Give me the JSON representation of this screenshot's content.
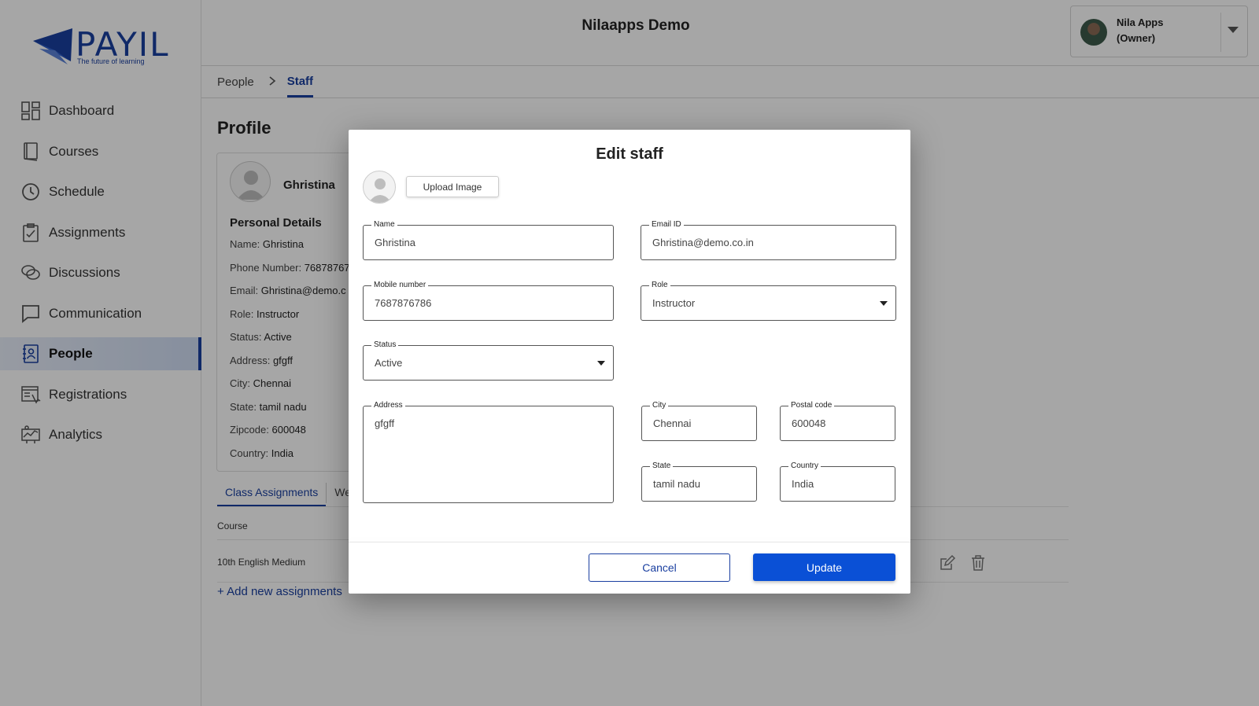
{
  "brand": {
    "logo_text": "PAYIL",
    "tagline": "The future of learning"
  },
  "sidebar": {
    "items": [
      {
        "label": "Dashboard",
        "icon": "dashboard-icon"
      },
      {
        "label": "Courses",
        "icon": "book-icon"
      },
      {
        "label": "Schedule",
        "icon": "clock-icon"
      },
      {
        "label": "Assignments",
        "icon": "clipboard-icon"
      },
      {
        "label": "Discussions",
        "icon": "chat-bubbles-icon"
      },
      {
        "label": "Communication",
        "icon": "message-icon"
      },
      {
        "label": "People",
        "icon": "contacts-icon",
        "active": true
      },
      {
        "label": "Registrations",
        "icon": "registration-form-icon"
      },
      {
        "label": "Analytics",
        "icon": "analytics-icon"
      }
    ]
  },
  "header": {
    "title": "Nilaapps Demo",
    "user": {
      "name": "Nila Apps",
      "role": "(Owner)"
    }
  },
  "breadcrumb": {
    "parent": "People",
    "current": "Staff"
  },
  "profile": {
    "title": "Profile",
    "name": "Ghristina",
    "section_title": "Personal Details",
    "rows": [
      {
        "key": "Name:",
        "value": "Ghristina"
      },
      {
        "key": "Phone Number:",
        "value": "76878767"
      },
      {
        "key": "Email:",
        "value": "Ghristina@demo.c"
      },
      {
        "key": "Role:",
        "value": "Instructor"
      },
      {
        "key": "Status:",
        "value": "Active"
      },
      {
        "key": "Address:",
        "value": "gfgff"
      },
      {
        "key": "City:",
        "value": "Chennai"
      },
      {
        "key": "State:",
        "value": "tamil nadu"
      },
      {
        "key": "Zipcode:",
        "value": "600048"
      },
      {
        "key": "Country:",
        "value": "India"
      }
    ],
    "tabs": [
      "Class Assignments",
      "We"
    ],
    "table": {
      "header": "Course",
      "rows": [
        "10th English Medium"
      ]
    },
    "add_link": "+ Add new assignments"
  },
  "modal": {
    "title": "Edit staff",
    "upload_label": "Upload Image",
    "fields": {
      "name": {
        "label": "Name",
        "value": "Ghristina"
      },
      "email": {
        "label": "Email ID",
        "value": "Ghristina@demo.co.in"
      },
      "mobile": {
        "label": "Mobile number",
        "value": "7687876786"
      },
      "role": {
        "label": "Role",
        "value": "Instructor"
      },
      "status": {
        "label": "Status",
        "value": "Active"
      },
      "address": {
        "label": "Address",
        "value": "gfgff"
      },
      "city": {
        "label": "City",
        "value": "Chennai"
      },
      "postal": {
        "label": "Postal code",
        "value": "600048"
      },
      "state": {
        "label": "State",
        "value": "tamil nadu"
      },
      "country": {
        "label": "Country",
        "value": "India"
      }
    },
    "cancel_label": "Cancel",
    "update_label": "Update"
  },
  "colors": {
    "brand": "#1a3fa0",
    "primary_button": "#0a50d6"
  }
}
